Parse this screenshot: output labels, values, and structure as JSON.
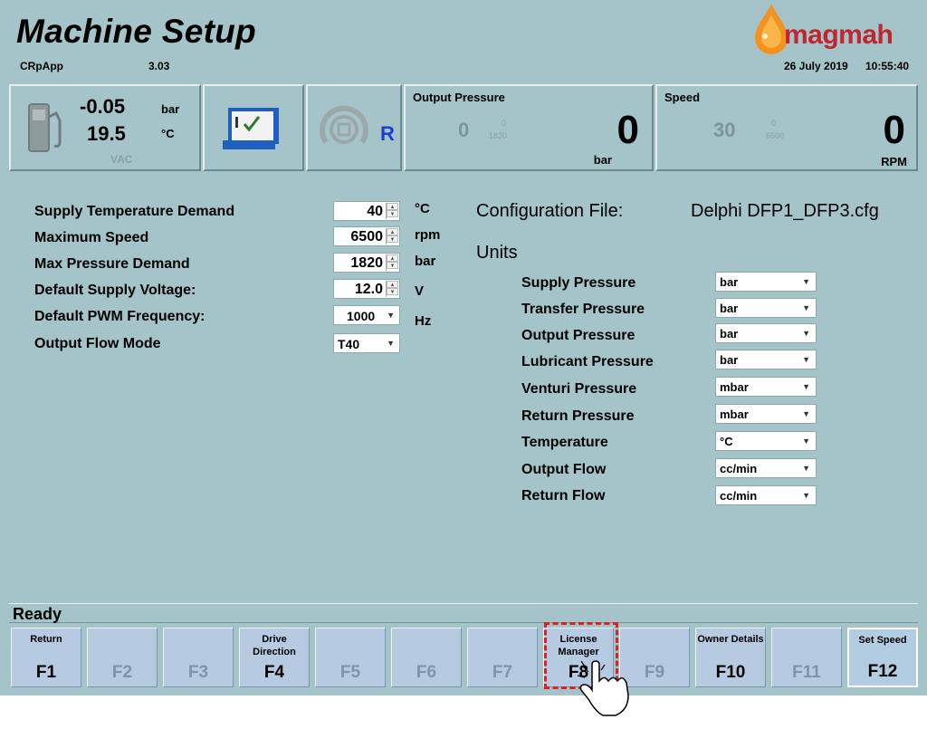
{
  "header": {
    "title": "Machine Setup",
    "app_name": "CRpApp",
    "version": "3.03",
    "date": "26 July 2019",
    "time": "10:55:40",
    "logo_text": "magmah",
    "brand_color": "#c0262d"
  },
  "gauges": {
    "fuel": {
      "pressure": "-0.05",
      "pressure_unit": "bar",
      "temperature": "19.5",
      "temperature_unit": "°C",
      "supply": "VAC",
      "icon": "fuel-pump-icon"
    },
    "status_icon": "checklist-icon",
    "direction": {
      "value": "R",
      "icon": "rotation-icon"
    },
    "output_pressure": {
      "title": "Output Pressure",
      "demand": "0",
      "min": "0",
      "max": "1820",
      "value": "0",
      "unit": "bar"
    },
    "speed": {
      "title": "Speed",
      "demand": "30",
      "min": "0",
      "max": "6500",
      "value": "0",
      "unit": "RPM"
    }
  },
  "settings": [
    {
      "label": "Supply Temperature Demand",
      "value": "40",
      "unit": "°C",
      "control": "spin"
    },
    {
      "label": "Maximum Speed",
      "value": "6500",
      "unit": "rpm",
      "control": "spin"
    },
    {
      "label": "Max Pressure Demand",
      "value": "1820",
      "unit": "bar",
      "control": "spin"
    },
    {
      "label": "Default Supply Voltage:",
      "value": "12.0",
      "unit": "V",
      "control": "spin"
    },
    {
      "label": "Default PWM Frequency:",
      "value": "1000",
      "unit": "Hz",
      "control": "combo"
    },
    {
      "label": "Output Flow Mode",
      "value": "T40",
      "unit": "",
      "control": "combo"
    }
  ],
  "config": {
    "label": "Configuration File:",
    "file": "Delphi DFP1_DFP3.cfg",
    "units_title": "Units"
  },
  "units": [
    {
      "label": "Supply Pressure",
      "value": "bar"
    },
    {
      "label": "Transfer Pressure",
      "value": "bar"
    },
    {
      "label": "Output Pressure",
      "value": "bar"
    },
    {
      "label": "Lubricant Pressure",
      "value": "bar"
    },
    {
      "label": "Venturi Pressure",
      "value": "mbar"
    },
    {
      "label": "Return Pressure",
      "value": "mbar"
    },
    {
      "label": "Temperature",
      "value": "°C"
    },
    {
      "label": "Output Flow",
      "value": "cc/min"
    },
    {
      "label": "Return Flow",
      "value": "cc/min"
    }
  ],
  "status": {
    "text": "Ready"
  },
  "fkeys": [
    {
      "key": "F1",
      "label": "Return",
      "enabled": true
    },
    {
      "key": "F2",
      "label": "",
      "enabled": false
    },
    {
      "key": "F3",
      "label": "",
      "enabled": false
    },
    {
      "key": "F4",
      "label": "Drive Direction",
      "enabled": true
    },
    {
      "key": "F5",
      "label": "",
      "enabled": false
    },
    {
      "key": "F6",
      "label": "",
      "enabled": false
    },
    {
      "key": "F7",
      "label": "",
      "enabled": false
    },
    {
      "key": "F8",
      "label": "License Manager",
      "enabled": true
    },
    {
      "key": "F9",
      "label": "",
      "enabled": false
    },
    {
      "key": "F10",
      "label": "Owner Details",
      "enabled": true
    },
    {
      "key": "F11",
      "label": "",
      "enabled": false
    },
    {
      "key": "F12",
      "label": "Set Speed",
      "enabled": true
    }
  ],
  "annotation": {
    "highlight_color": "#e02020",
    "pointer_icon": "hand-pointer-icon"
  }
}
